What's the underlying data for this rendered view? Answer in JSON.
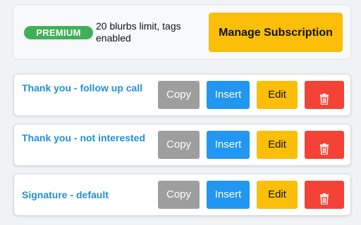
{
  "subscription": {
    "badge": "PREMIUM",
    "plan_text": "20 blurbs limit, tags enabled",
    "manage_label": "Manage Subscription"
  },
  "blurbs": [
    {
      "title": "Thank you - follow up call",
      "copy": "Copy",
      "insert": "Insert",
      "edit": "Edit",
      "delete_icon": "trash-icon"
    },
    {
      "title": "Thank you - not interested",
      "copy": "Copy",
      "insert": "Insert",
      "edit": "Edit",
      "delete_icon": "trash-icon"
    },
    {
      "title": "Signature - default",
      "copy": "Copy",
      "insert": "Insert",
      "edit": "Edit",
      "delete_icon": "trash-icon"
    }
  ],
  "colors": {
    "premium_badge": "#3fb056",
    "manage_button": "#fbbf09",
    "title_text": "#1f8fd8",
    "copy_button": "#9e9e9e",
    "insert_button": "#2196f3",
    "edit_button": "#fbbf09",
    "delete_button": "#f44336"
  }
}
